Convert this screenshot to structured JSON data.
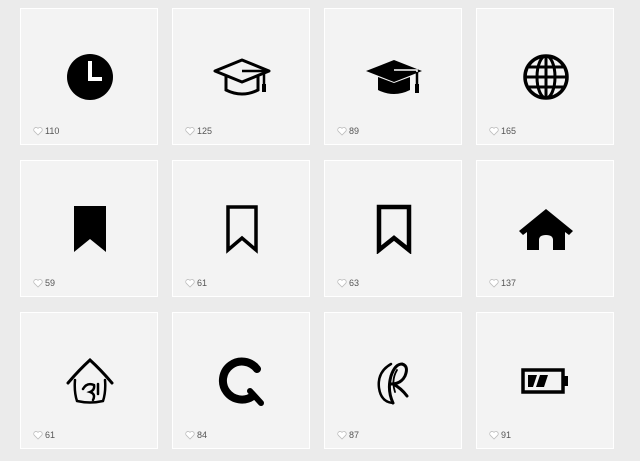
{
  "icons": [
    {
      "icon": "clock-icon",
      "count": "110"
    },
    {
      "icon": "graduation-cap-outline-icon",
      "count": "125"
    },
    {
      "icon": "graduation-cap-solid-icon",
      "count": "89"
    },
    {
      "icon": "globe-icon",
      "count": "165"
    },
    {
      "icon": "bookmark-solid-icon",
      "count": "59"
    },
    {
      "icon": "bookmark-outline-icon",
      "count": "61"
    },
    {
      "icon": "bookmark-outline-bold-icon",
      "count": "63"
    },
    {
      "icon": "home-icon",
      "count": "137"
    },
    {
      "icon": "sketch-house-icon",
      "count": "61"
    },
    {
      "icon": "q-logo-icon",
      "count": "84"
    },
    {
      "icon": "script-r-logo-icon",
      "count": "87"
    },
    {
      "icon": "battery-low-icon",
      "count": "91"
    }
  ],
  "colors": {
    "page_background": "#ebebeb",
    "card_background": "#f3f3f3",
    "icon_color": "#000000",
    "count_color": "#555555"
  }
}
